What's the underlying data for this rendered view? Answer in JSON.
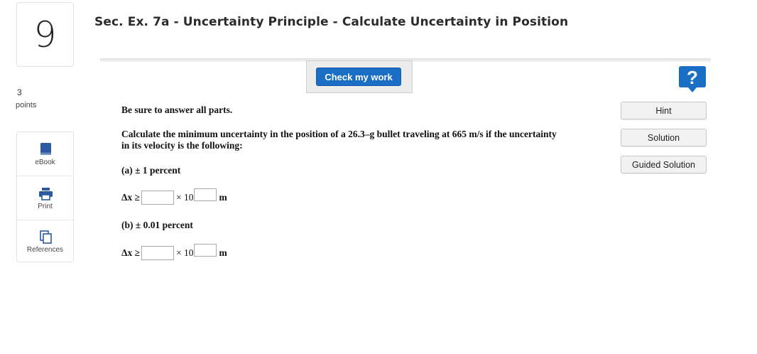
{
  "question": {
    "number": "9",
    "title": "Sec. Ex. 7a - Uncertainty Principle - Calculate Uncertainty in Position",
    "points_value": "3",
    "points_label": "points"
  },
  "sidebar": {
    "items": [
      {
        "label": "eBook",
        "icon": "ebook-icon"
      },
      {
        "label": "Print",
        "icon": "print-icon"
      },
      {
        "label": "References",
        "icon": "references-icon"
      }
    ]
  },
  "toolbar": {
    "check_label": "Check my work",
    "help_icon": "help-icon",
    "help_symbol": "?"
  },
  "resources": {
    "hint": "Hint",
    "solution": "Solution",
    "guided": "Guided Solution"
  },
  "content": {
    "instruction": "Be sure to answer all parts.",
    "prompt": "Calculate the minimum uncertainty in the position of a 26.3–g bullet traveling at 665 m/s if the uncertainty in its velocity is the following:",
    "part_a": "(a) ± 1 percent",
    "part_b": "(b) ± 0.01 percent"
  },
  "answer": {
    "prefix": "Δx ≥",
    "times_ten": "× 10",
    "unit": "m"
  },
  "colors": {
    "accent": "#1a6fc4",
    "sidebar_icon": "#2c5aa0"
  }
}
